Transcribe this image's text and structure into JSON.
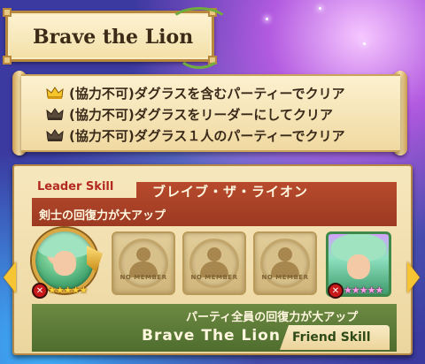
{
  "title": "Brave the Lion",
  "conditions": [
    {
      "icon": "gold-crown-icon",
      "text": "(協力不可)ダグラスを含むパーティーでクリア"
    },
    {
      "icon": "silver-crown-icon",
      "text": "(協力不可)ダグラスをリーダーにしてクリア"
    },
    {
      "icon": "silver-crown-icon",
      "text": "(協力不可)ダグラス１人のパーティーでクリア"
    }
  ],
  "leader_skill": {
    "label": "Leader Skill",
    "name": "ブレイブ・ザ・ライオン",
    "description": "剣士の回復力が大アップ"
  },
  "party": {
    "leader_stars": 5,
    "empty_slots": [
      {
        "label": "NO MEMBER"
      },
      {
        "label": "NO MEMBER"
      },
      {
        "label": "NO MEMBER"
      }
    ],
    "friend_stars": 5
  },
  "friend_skill": {
    "label": "Friend Skill",
    "name": "Brave The Lion",
    "description": "パーティ全員の回復力が大アップ"
  },
  "colors": {
    "leader_bar": "#b84a2c",
    "friend_bar": "#5c7b38",
    "parchment": "#f7e7bd",
    "gold": "#f7c533"
  }
}
